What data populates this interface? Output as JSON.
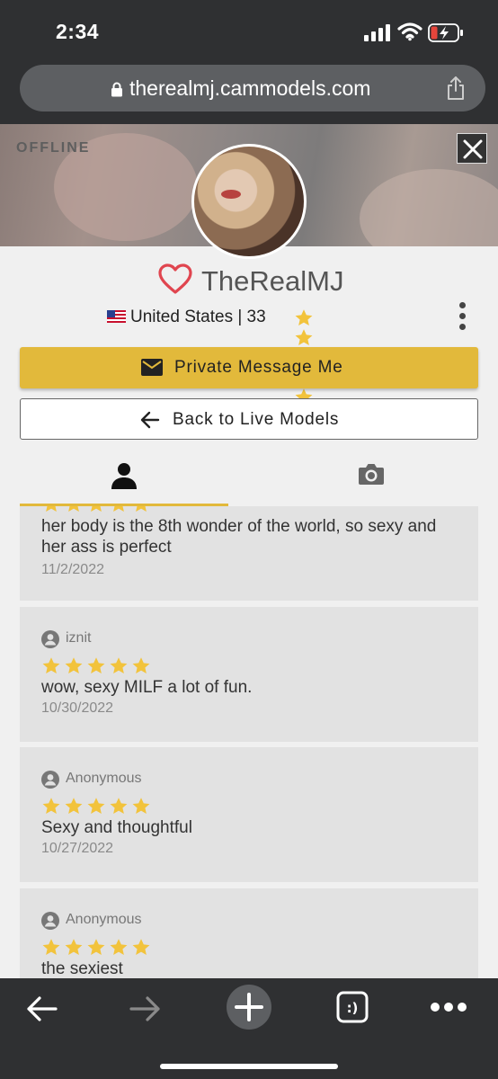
{
  "status_bar": {
    "time": "2:34"
  },
  "browser": {
    "url": "therealmj.cammodels.com"
  },
  "hero": {
    "status_label": "OFFLINE"
  },
  "profile": {
    "name": "TheRealMJ",
    "country": "United States",
    "age": "33",
    "meta_text": "United States | 33",
    "rating_stars": 5
  },
  "actions": {
    "private_message_label": "Private Message Me",
    "back_label": "Back to Live Models"
  },
  "tabs": [
    {
      "name": "profile-tab",
      "icon": "person-icon",
      "active": true
    },
    {
      "name": "photos-tab",
      "icon": "camera-icon",
      "active": false
    }
  ],
  "reviews": [
    {
      "user": "",
      "stars": 5,
      "text": "her body is the 8th wonder of the world, so sexy and her ass is perfect",
      "date": "11/2/2022"
    },
    {
      "user": "iznit",
      "stars": 5,
      "text": "wow, sexy MILF a lot of fun.",
      "date": "10/30/2022"
    },
    {
      "user": "Anonymous",
      "stars": 5,
      "text": "Sexy and thoughtful",
      "date": "10/27/2022"
    },
    {
      "user": "Anonymous",
      "stars": 5,
      "text": "the sexiest",
      "date": ""
    }
  ],
  "toolbar": {
    "icons": [
      "back-arrow-icon",
      "forward-arrow-icon",
      "new-tab-plus-icon",
      "tabs-icon",
      "more-icon"
    ]
  },
  "colors": {
    "accent": "#e2b93b",
    "star": "#f2c33c",
    "heart": "#e0454f",
    "chrome": "#2f3032"
  }
}
